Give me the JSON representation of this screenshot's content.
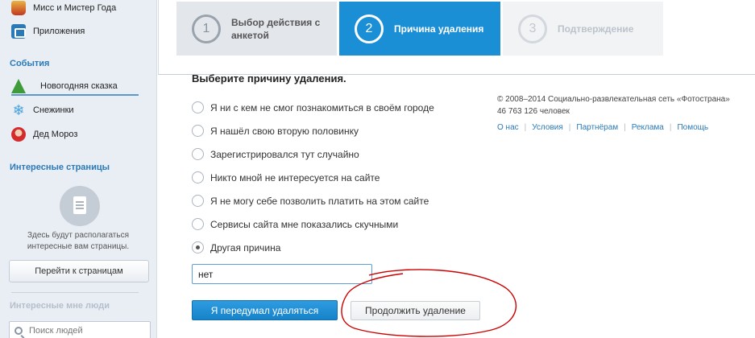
{
  "sidebar": {
    "items_top": [
      {
        "label": "Мисс и Мистер Года",
        "icon": "crown-icon"
      },
      {
        "label": "Приложения",
        "icon": "apps-icon"
      }
    ],
    "events_heading": "События",
    "events": [
      {
        "label": "Новогодняя сказка",
        "icon": "christmas-tree-icon"
      },
      {
        "label": "Снежинки",
        "icon": "snowflake-icon"
      },
      {
        "label": "Дед Мороз",
        "icon": "santa-icon"
      }
    ],
    "interesting_pages_heading": "Интересные страницы",
    "interesting_pages_note": "Здесь будут располагаться интересные вам страницы.",
    "go_to_pages_button": "Перейти к страницам",
    "interesting_people_heading": "Интересные мне люди",
    "search_placeholder": "Поиск людей"
  },
  "steps": [
    {
      "number": "1",
      "label": "Выбор действия с анкетой",
      "state": "done"
    },
    {
      "number": "2",
      "label": "Причина удаления",
      "state": "active"
    },
    {
      "number": "3",
      "label": "Подтверждение",
      "state": "pending"
    }
  ],
  "form": {
    "title": "Выберите причину удаления.",
    "options": [
      {
        "label": "Я ни с кем не смог познакомиться в своём городе",
        "checked": false
      },
      {
        "label": "Я нашёл свою вторую половинку",
        "checked": false
      },
      {
        "label": "Зарегистрировался тут случайно",
        "checked": false
      },
      {
        "label": "Никто мной не интересуется на сайте",
        "checked": false
      },
      {
        "label": "Я не могу себе позволить платить на этом сайте",
        "checked": false
      },
      {
        "label": "Сервисы сайта мне показались скучными",
        "checked": false
      },
      {
        "label": "Другая причина",
        "checked": true
      }
    ],
    "other_reason_value": "нет",
    "stay_button": "Я передумал удаляться",
    "continue_button": "Продолжить удаление"
  },
  "footer": {
    "copyright": "© 2008–2014 Социально-развлекательная сеть «Фотострана»",
    "users_count": "46 763 126 человек",
    "links": [
      "О нас",
      "Условия",
      "Партнёрам",
      "Реклама",
      "Помощь"
    ]
  },
  "colors": {
    "accent": "#1a8fd6",
    "link": "#2a7ab8",
    "annotation": "#cc0000"
  }
}
